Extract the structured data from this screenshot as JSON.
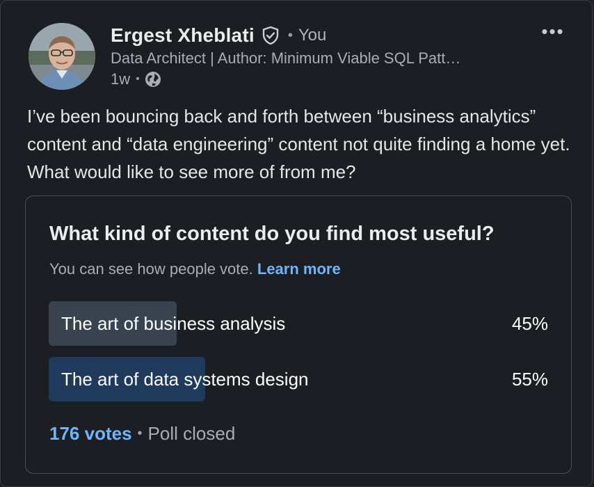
{
  "author": {
    "name": "Ergest Xheblati",
    "relation": "You",
    "headline": "Data Architect | Author: Minimum Viable SQL Patt…",
    "time": "1w",
    "verified_icon": "verified-shield-icon",
    "visibility_icon": "globe-icon"
  },
  "menu": {
    "more_label": "•••"
  },
  "post": {
    "text": "I’ve been bouncing back and forth between “business analytics” content and “data engineering” content not quite finding a home yet. What would like to see more of from me?"
  },
  "poll": {
    "question": "What kind of content do you find most useful?",
    "note": "You can see how people vote.",
    "learn_more": "Learn more",
    "options": [
      {
        "label": "The art of business analysis",
        "percent": "45%",
        "share": 0.45,
        "color": "#38434f",
        "leading": false
      },
      {
        "label": "The art of data systems design",
        "percent": "55%",
        "share": 0.55,
        "color": "#1f3a5a",
        "leading": true
      }
    ],
    "votes": "176 votes",
    "status": "Poll closed"
  },
  "colors": {
    "background": "#1b1f23",
    "link": "#70b5f9",
    "muted_text": "#a9aeb3"
  }
}
